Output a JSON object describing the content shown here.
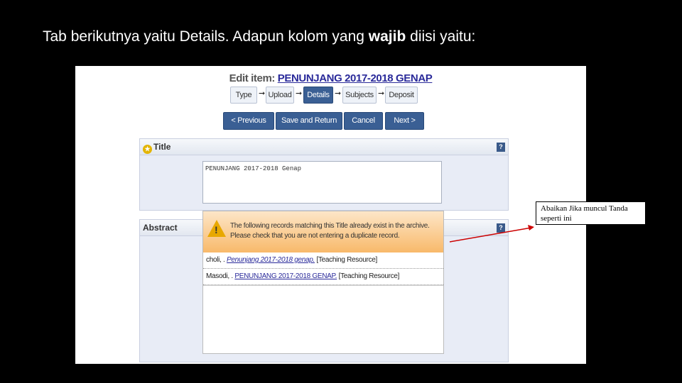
{
  "slide": {
    "title_prefix": "Tab berikutnya yaitu Details. Adapun kolom yang",
    "title_bold": "wajib",
    "title_suffix": "diisi yaitu:"
  },
  "edit": {
    "label": "Edit item:",
    "record": "PENUNJANG 2017-2018 GENAP"
  },
  "steps": [
    "Type",
    "Upload",
    "Details",
    "Subjects",
    "Deposit"
  ],
  "active_step": "Details",
  "nav": {
    "previous": "< Previous",
    "save_return": "Save and Return",
    "cancel": "Cancel",
    "next": "Next >"
  },
  "title_field": {
    "label": "Title",
    "value": "PENUNJANG 2017-2018 Genap"
  },
  "abstract_field": {
    "label": "Abstract"
  },
  "help_label": "?",
  "duplicate_warning": {
    "message": "The following records matching this Title already exist in the archive. Please check that you are not entering a duplicate record.",
    "records": [
      {
        "author": "choli, .",
        "title": "Penunjang 2017-2018 genap.",
        "type": "[Teaching Resource]"
      },
      {
        "author": "Masodi, .",
        "title": "PENUNJANG 2017-2018 GENAP.",
        "type": "[Teaching Resource]"
      }
    ]
  },
  "note": "Abaikan Jika muncul Tanda seperti ini",
  "colors": {
    "accent": "#3a5f94",
    "warning": "#f8b96a",
    "arrow": "#cc0000"
  }
}
